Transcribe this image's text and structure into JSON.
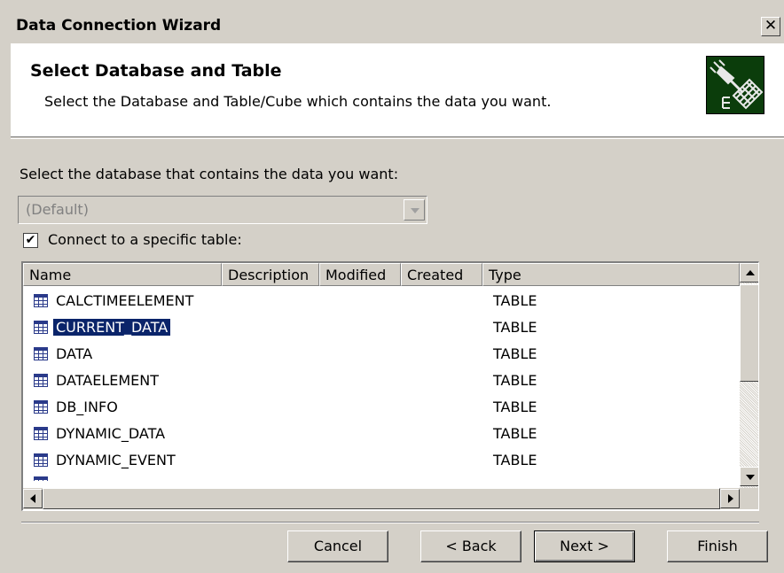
{
  "window": {
    "title": "Data Connection Wizard",
    "close_glyph": "✕"
  },
  "header": {
    "title": "Select Database and Table",
    "subtitle": "Select the Database and Table/Cube which contains the data you want.",
    "icon": "data-connection-plug-icon"
  },
  "database": {
    "label": "Select the database that contains the data you want:",
    "selected": "(Default)"
  },
  "specific_table": {
    "label": "Connect to a specific table:",
    "checked": true,
    "check_glyph": "✔"
  },
  "table_list": {
    "columns": [
      "Name",
      "Description",
      "Modified",
      "Created",
      "Type"
    ],
    "rows": [
      {
        "name": "CALCTIMEELEMENT",
        "type": "TABLE"
      },
      {
        "name": "CURRENT_DATA",
        "type": "TABLE"
      },
      {
        "name": "DATA",
        "type": "TABLE"
      },
      {
        "name": "DATAELEMENT",
        "type": "TABLE"
      },
      {
        "name": "DB_INFO",
        "type": "TABLE"
      },
      {
        "name": "DYNAMIC_DATA",
        "type": "TABLE"
      },
      {
        "name": "DYNAMIC_EVENT",
        "type": "TABLE"
      }
    ],
    "selected_row": "CURRENT_DATA"
  },
  "buttons": {
    "cancel": "Cancel",
    "back": "< Back",
    "next": "Next >",
    "finish": "Finish"
  }
}
